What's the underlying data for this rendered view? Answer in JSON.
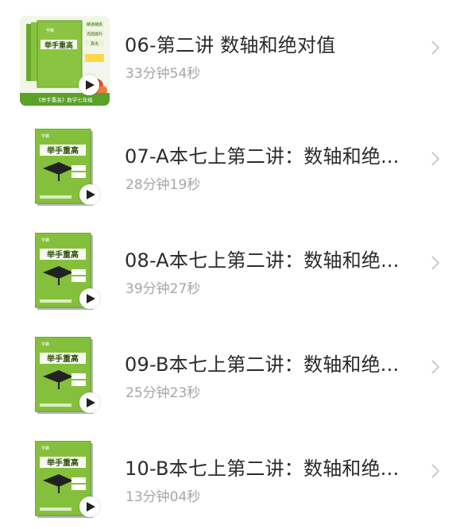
{
  "lessons": [
    {
      "title": "06-第二讲 数轴和绝对值",
      "duration": "33分钟54秒",
      "cover": "book-stack-cover"
    },
    {
      "title": "07-A本七上第二讲：数轴和绝...",
      "duration": "28分钟19秒",
      "cover": "book-cover"
    },
    {
      "title": "08-A本七上第二讲：数轴和绝...",
      "duration": "39分钟27秒",
      "cover": "book-cover"
    },
    {
      "title": "09-B本七上第二讲：数轴和绝...",
      "duration": "25分钟23秒",
      "cover": "book-cover"
    },
    {
      "title": "10-B本七上第二讲：数轴和绝...",
      "duration": "13分钟04秒",
      "cover": "book-cover"
    }
  ],
  "cover_text": {
    "brand": "学霸",
    "series": "举手重高",
    "first_tags": [
      "精讲精练",
      "巩固提升",
      "直击"
    ],
    "first_caption": "《举手重高》数学七年级"
  },
  "colors": {
    "book_green": "#7fbd3a",
    "book_green_dark": "#5e9a23",
    "title_text": "#2b2b2b",
    "duration_text": "#a6a6a6",
    "chevron": "#c2c2c2"
  }
}
